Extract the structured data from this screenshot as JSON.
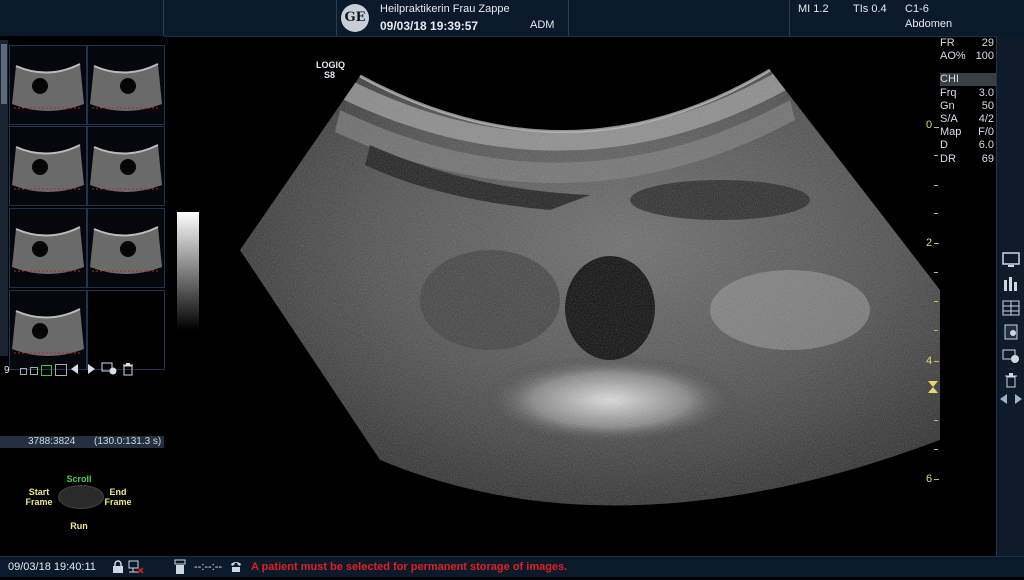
{
  "header": {
    "logo_text": "GE",
    "patient_name": "Heilpraktikerin Frau Zappe",
    "datetime": "09/03/18 19:39:57",
    "operator": "ADM",
    "mi": "MI 1.2",
    "tis": "TIs 0.4",
    "probe": "C1-6",
    "preset": "Abdomen"
  },
  "image": {
    "system_label_line1": "LOGIQ",
    "system_label_line2": "S8"
  },
  "depth_scale": {
    "labels": [
      "0",
      "2",
      "4",
      "6"
    ]
  },
  "params": {
    "rows": [
      {
        "k": "FR",
        "v": "29"
      },
      {
        "k": "AO%",
        "v": "100"
      },
      {
        "k": "CHI",
        "v": ""
      },
      {
        "k": "Frq",
        "v": "3.0"
      },
      {
        "k": "Gn",
        "v": "50"
      },
      {
        "k": "S/A",
        "v": "4/2"
      },
      {
        "k": "Map",
        "v": "F/0"
      },
      {
        "k": "D",
        "v": "6.0"
      },
      {
        "k": "DR",
        "v": "69"
      }
    ]
  },
  "clipboard": {
    "image_count": "9",
    "progress_frames": "3788:3824",
    "progress_time": "(130.0:131.3 s)"
  },
  "trackball": {
    "top": "Scroll",
    "left": "Start\nFrame",
    "right": "End\nFrame",
    "bottom": "Run"
  },
  "footer": {
    "datetime": "09/03/18 19:40:11",
    "time_placeholder": "--:--:--",
    "message": "A patient must be selected for permanent storage of images."
  },
  "colors": {
    "bar_bg": "#0b1a2a",
    "depth_color": "#e6d870",
    "message_color": "#e02020"
  }
}
